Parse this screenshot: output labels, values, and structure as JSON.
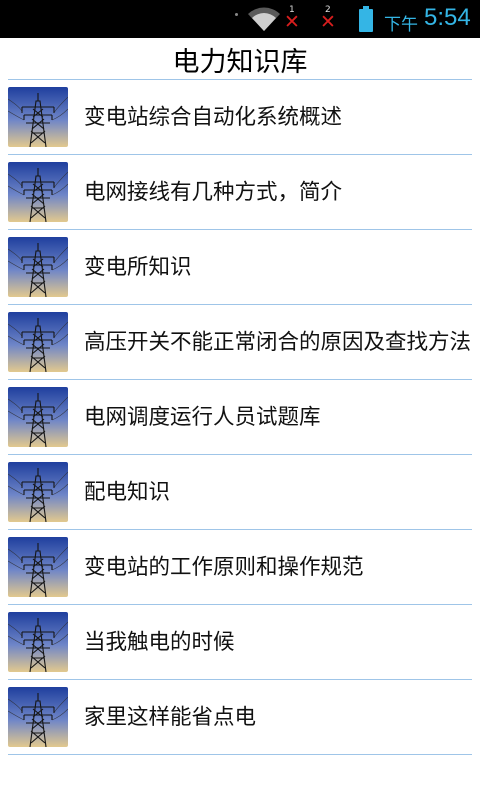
{
  "status_bar": {
    "sim1_number": "1",
    "sim2_number": "2",
    "sim_status_mark": "✕",
    "ampm": "下午",
    "time": "5:54",
    "icons": [
      "wifi-icon",
      "sim-no-signal-icon",
      "battery-icon"
    ],
    "accent_color": "#34b5e5"
  },
  "header": {
    "title": "电力知识库"
  },
  "list": {
    "thumbnail_icon": "power-tower-thumbnail",
    "divider_color": "#9fc5e8",
    "items": [
      {
        "label": "变电站综合自动化系统概述"
      },
      {
        "label": "电网接线有几种方式，简介"
      },
      {
        "label": "变电所知识"
      },
      {
        "label": "高压开关不能正常闭合的原因及查找方法"
      },
      {
        "label": "电网调度运行人员试题库"
      },
      {
        "label": "配电知识"
      },
      {
        "label": "变电站的工作原则和操作规范"
      },
      {
        "label": "当我触电的时候"
      },
      {
        "label": "家里这样能省点电"
      }
    ]
  }
}
